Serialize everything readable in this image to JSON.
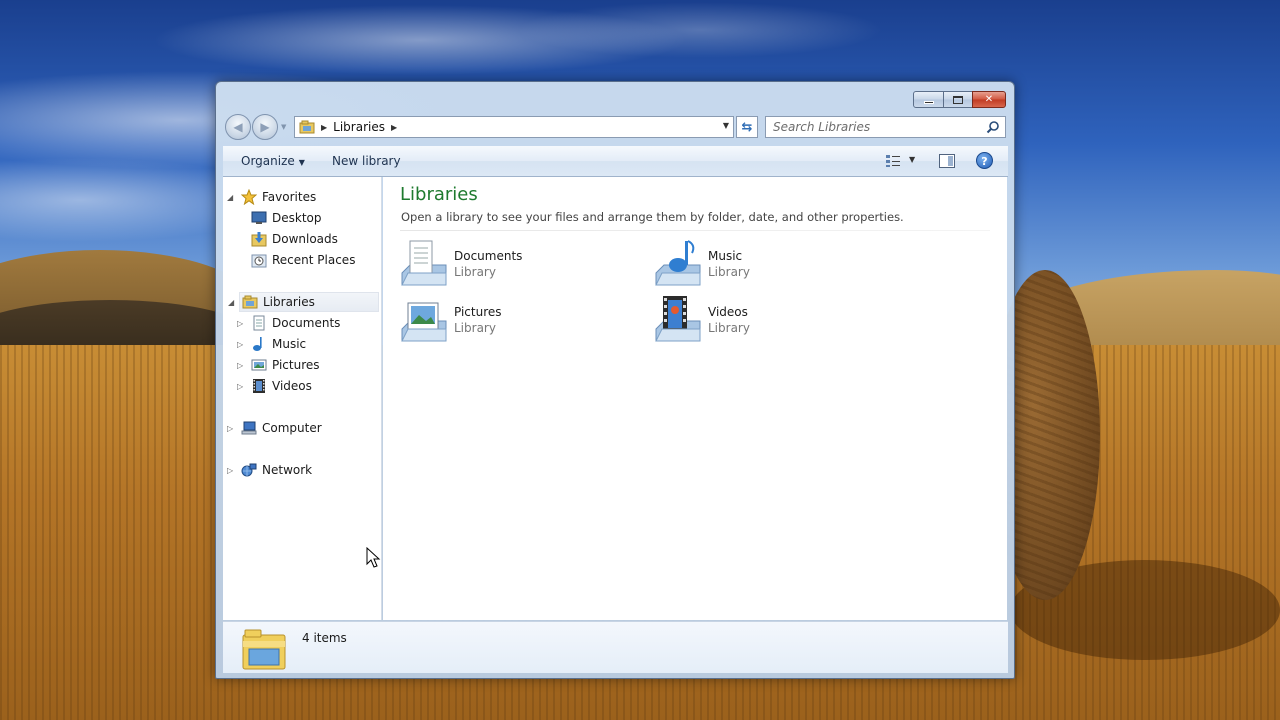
{
  "window": {
    "caption_buttons": {
      "minimize": "minimize",
      "maximize": "maximize",
      "close": "✕"
    }
  },
  "address_bar": {
    "crumbs": [
      "Libraries"
    ],
    "search_placeholder": "Search Libraries"
  },
  "command_bar": {
    "organize_label": "Organize",
    "new_library_label": "New library"
  },
  "nav_pane": {
    "favorites": {
      "label": "Favorites",
      "items": [
        {
          "label": "Desktop",
          "icon": "desktop-icon"
        },
        {
          "label": "Downloads",
          "icon": "downloads-icon"
        },
        {
          "label": "Recent Places",
          "icon": "recent-places-icon"
        }
      ]
    },
    "libraries": {
      "label": "Libraries",
      "items": [
        {
          "label": "Documents",
          "icon": "documents-icon"
        },
        {
          "label": "Music",
          "icon": "music-icon"
        },
        {
          "label": "Pictures",
          "icon": "pictures-icon"
        },
        {
          "label": "Videos",
          "icon": "videos-icon"
        }
      ]
    },
    "computer": {
      "label": "Computer"
    },
    "network": {
      "label": "Network"
    }
  },
  "content": {
    "title": "Libraries",
    "description": "Open a library to see your files and arrange them by folder, date, and other properties.",
    "libraries": [
      {
        "name": "Documents",
        "type": "Library"
      },
      {
        "name": "Music",
        "type": "Library"
      },
      {
        "name": "Pictures",
        "type": "Library"
      },
      {
        "name": "Videos",
        "type": "Library"
      }
    ]
  },
  "status_bar": {
    "item_count": "4 items"
  },
  "colors": {
    "title_green": "#1e7a2e",
    "window_frame": "#c7d9ee",
    "close_red": "#c9452b"
  }
}
